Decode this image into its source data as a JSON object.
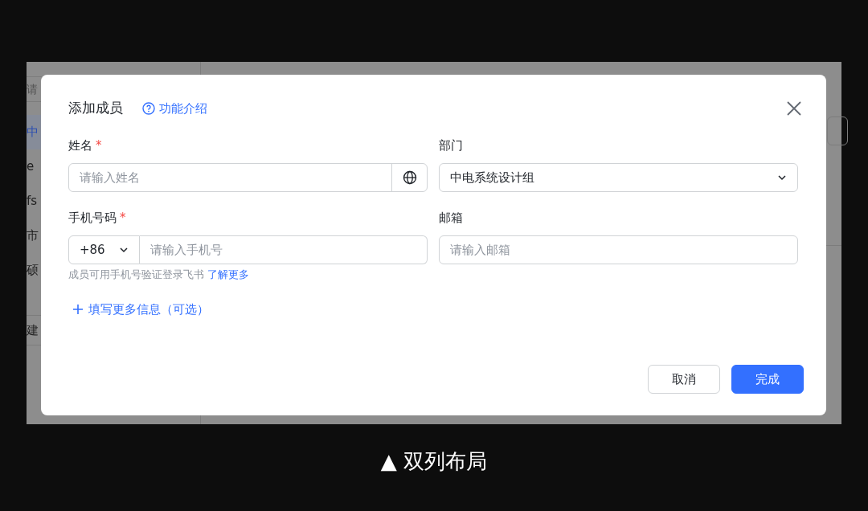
{
  "background": {
    "search_placeholder": "请",
    "tree_items": [
      {
        "label": "中",
        "selected": true
      },
      {
        "label": "e",
        "selected": false
      },
      {
        "label": "fs",
        "selected": false
      },
      {
        "label": "市",
        "selected": false
      },
      {
        "label": "硕",
        "selected": false
      }
    ],
    "footer_button": "建"
  },
  "dialog": {
    "title": "添加成员",
    "help_link": "功能介绍",
    "fields": [
      {
        "label": "姓名",
        "required_mark": "*",
        "kind": "text-with-icon",
        "placeholder": "请输入姓名"
      },
      {
        "label": "部门",
        "kind": "select",
        "value": "中电系统设计组"
      },
      {
        "label": "手机号码",
        "required_mark": "*",
        "kind": "phone",
        "prefix": "+86",
        "placeholder": "请输入手机号",
        "hint": "成员可用手机号验证登录飞书",
        "hint_link": "了解更多"
      },
      {
        "label": "邮箱",
        "kind": "text",
        "placeholder": "请输入邮箱"
      }
    ],
    "more_link": "填写更多信息（可选）",
    "buttons": [
      {
        "label": "取消",
        "kind": "secondary"
      },
      {
        "label": "完成",
        "kind": "primary"
      }
    ]
  },
  "caption": "▲ 双列布局"
}
